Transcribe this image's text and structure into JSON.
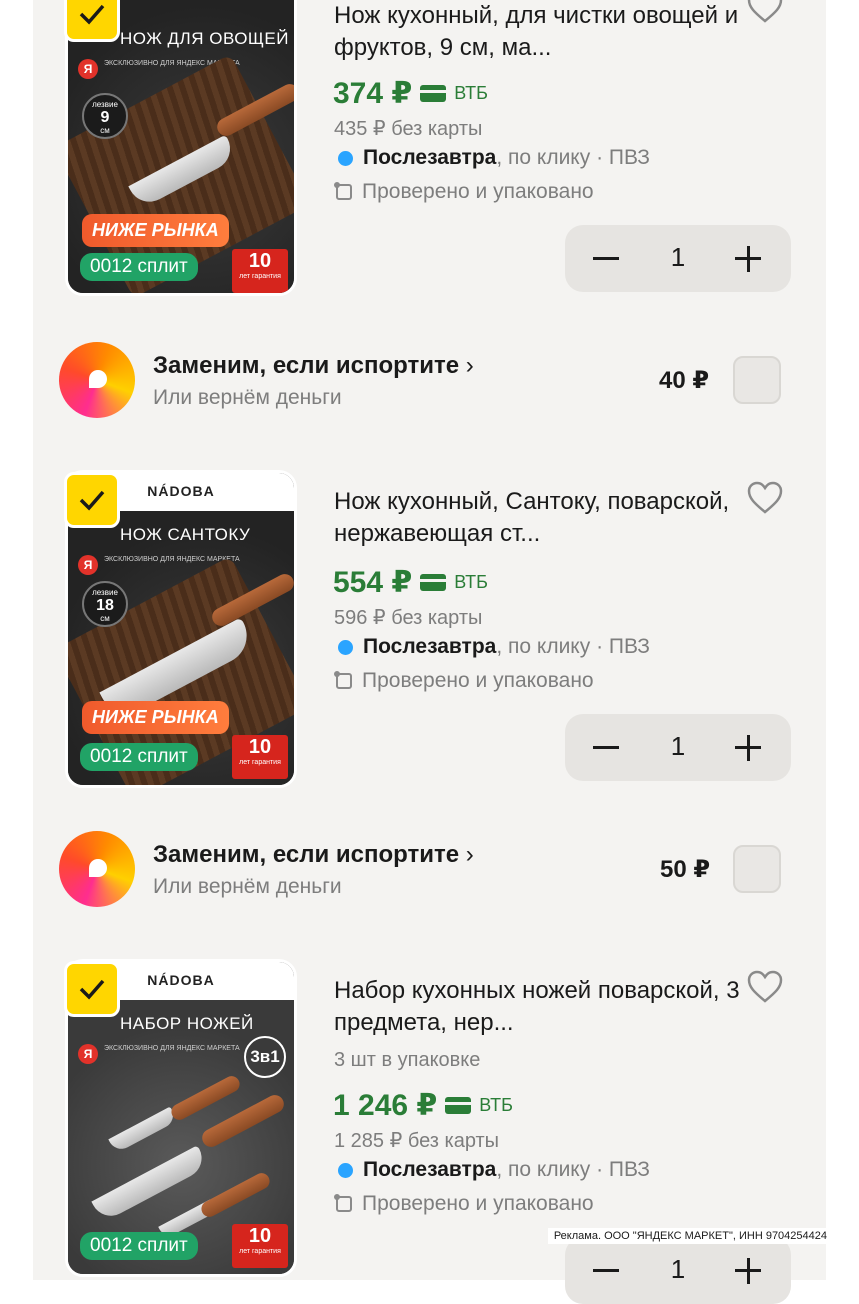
{
  "items": [
    {
      "brand": "",
      "image_title": "НОЖ ДЛЯ ОВОЩЕЙ",
      "image_length_label": "лезвие",
      "image_length_value": "9",
      "image_length_unit": "см",
      "image_exclusive": "ЭКСКЛЮЗИВНО ДЛЯ ЯНДЕКС МАРКЕТА",
      "badge_below_market": "НИЖЕ РЫНКА",
      "split_label": "0012 сплит",
      "warranty_years": "10",
      "warranty_label": "лет гарантия",
      "title": "Нож кухонный, для чистки овощей и фруктов, 9 см, ма...",
      "units": "",
      "price": "374 ₽",
      "bank": "ВТБ",
      "old_price": "435 ₽ без карты",
      "delivery_bold": "Послезавтра",
      "delivery_rest": ", по клику · ПВЗ",
      "checked": "Проверено и упаковано",
      "quantity": "1"
    },
    {
      "brand": "NÁDOBA",
      "image_title": "НОЖ САНТОКУ",
      "image_length_label": "лезвие",
      "image_length_value": "18",
      "image_length_unit": "см",
      "image_exclusive": "ЭКСКЛЮЗИВНО ДЛЯ ЯНДЕКС МАРКЕТА",
      "badge_below_market": "НИЖЕ РЫНКА",
      "split_label": "0012 сплит",
      "warranty_years": "10",
      "warranty_label": "лет гарантия",
      "title": "Нож кухонный, Сантоку, поварской, нержавеющая ст...",
      "units": "",
      "price": "554 ₽",
      "bank": "ВТБ",
      "old_price": "596 ₽ без карты",
      "delivery_bold": "Послезавтра",
      "delivery_rest": ", по клику · ПВЗ",
      "checked": "Проверено и упаковано",
      "quantity": "1"
    },
    {
      "brand": "NÁDOBA",
      "image_title": "НАБОР НОЖЕЙ",
      "image_set_badge": "3в1",
      "image_exclusive": "ЭКСКЛЮЗИВНО ДЛЯ ЯНДЕКС МАРКЕТА",
      "split_label": "0012 сплит",
      "warranty_years": "10",
      "warranty_label": "лет гарантия",
      "title": "Набор кухонных ножей поварской, 3 предмета, нер...",
      "units": "3 шт в упаковке",
      "price": "1 246 ₽",
      "bank": "ВТБ",
      "old_price": "1 285 ₽ без карты",
      "delivery_bold": "Послезавтра",
      "delivery_rest": ", по клику · ПВЗ",
      "checked": "Проверено и упаковано",
      "quantity": "1"
    }
  ],
  "insurance": [
    {
      "title": "Заменим, если испортите",
      "subtitle": "Или вернём деньги",
      "price": "40 ₽"
    },
    {
      "title": "Заменим, если испортите",
      "subtitle": "Или вернём деньги",
      "price": "50 ₽"
    }
  ],
  "ad_note": "Реклама. ООО \"ЯНДЕКС МАРКЕТ\", ИНН 9704254424",
  "colors": {
    "price_green": "#2a7d37",
    "check_yellow": "#ffd600",
    "delivery_dot": "#2aa4ff",
    "panel_bg": "#f4f3f1"
  }
}
